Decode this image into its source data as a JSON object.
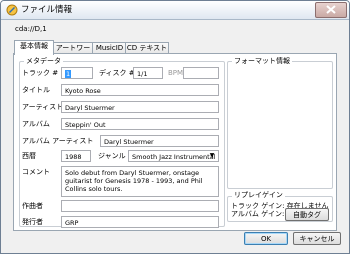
{
  "window": {
    "title": "ファイル情報",
    "close_icon": "close-icon"
  },
  "path": "cda://D,1",
  "tabs": [
    {
      "label": "基本情報",
      "active": true
    },
    {
      "label": "アートワーク",
      "active": false
    },
    {
      "label": "MusicID",
      "active": false
    },
    {
      "label": "CD テキスト",
      "active": false
    }
  ],
  "metadata": {
    "group_label": "メタデータ",
    "track_label": "トラック #",
    "track_value": "1",
    "disc_label": "ディスク #",
    "disc_value": "1/1",
    "bpm_label": "BPM",
    "bpm_value": "",
    "title_label": "タイトル",
    "title_value": "Kyoto Rose",
    "artist_label": "アーティスト",
    "artist_value": "Daryl Stuermer",
    "album_label": "アルバム",
    "album_value": "Steppin' Out",
    "album_artist_label": "アルバム アーティスト",
    "album_artist_value": "Daryl Stuermer",
    "year_label": "西暦",
    "year_value": "1988",
    "genre_label": "ジャンル",
    "genre_value": "Smooth Jazz Instrumental",
    "comment_label": "コメント",
    "comment_value": "Solo debut from Daryl Stuermer, onstage guitarist for Genesis 1978 - 1993, and Phil Collins solo tours.",
    "composer_label": "作曲者",
    "composer_value": "",
    "publisher_label": "発行者",
    "publisher_value": "GRP"
  },
  "format": {
    "group_label": "フォーマット情報"
  },
  "replaygain": {
    "group_label": "リプレイゲイン",
    "track_gain": "トラック ゲイン: 存在しません",
    "album_gain": "アルバム ゲイン: 存在しません"
  },
  "buttons": {
    "auto_tag": "自動タグ",
    "ok": "OK",
    "cancel": "キャンセル"
  }
}
